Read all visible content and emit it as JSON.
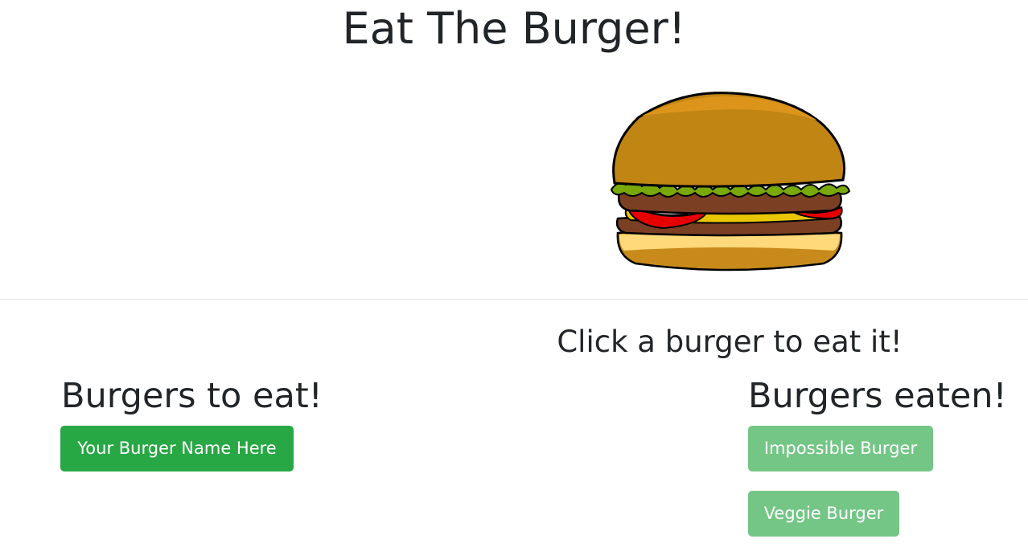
{
  "header": {
    "title": "Eat The Burger!"
  },
  "hero": {
    "image_icon": "hamburger-illustration"
  },
  "instructions": "Click a burger to eat it!",
  "columns": {
    "to_eat": {
      "heading": "Burgers to eat!",
      "burgers": [
        "Your Burger Name Here"
      ]
    },
    "eaten": {
      "heading": "Burgers eaten!",
      "burgers": [
        "Impossible Burger",
        "Veggie Burger"
      ]
    }
  },
  "colors": {
    "button_green": "#28a745",
    "button_green_disabled": "#74c686",
    "text": "#212529"
  }
}
